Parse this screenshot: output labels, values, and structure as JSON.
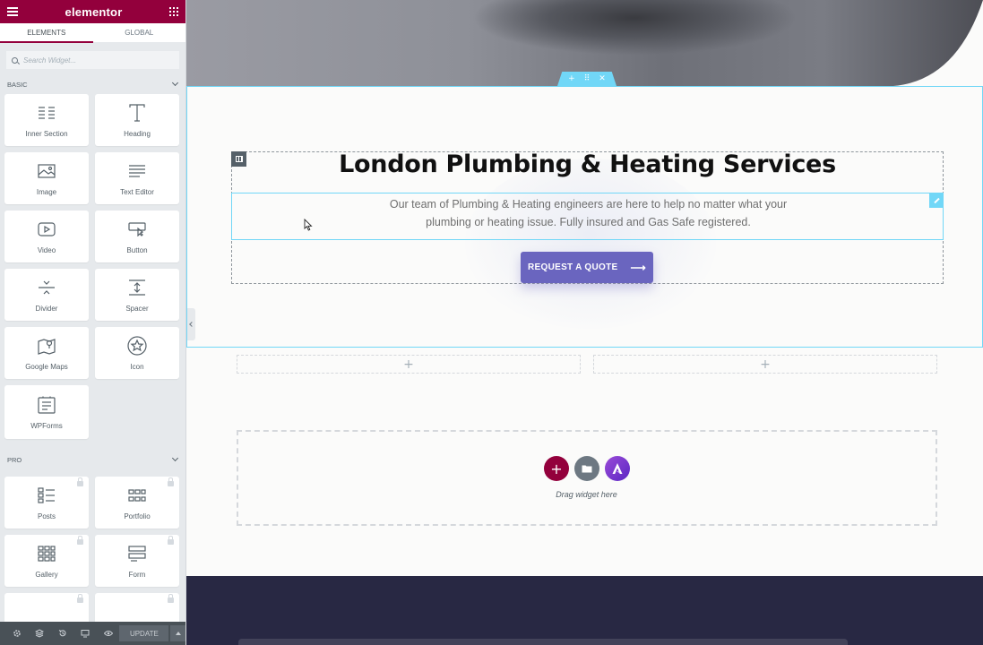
{
  "sidebar": {
    "logo": "elementor",
    "tabs": [
      "ELEMENTS",
      "GLOBAL"
    ],
    "search_placeholder": "Search Widget...",
    "categories": {
      "basic": {
        "title": "BASIC",
        "items": [
          {
            "label": "Inner Section",
            "icon": "inner-section-icon"
          },
          {
            "label": "Heading",
            "icon": "heading-icon"
          },
          {
            "label": "Image",
            "icon": "image-icon"
          },
          {
            "label": "Text Editor",
            "icon": "text-editor-icon"
          },
          {
            "label": "Video",
            "icon": "video-icon"
          },
          {
            "label": "Button",
            "icon": "button-icon"
          },
          {
            "label": "Divider",
            "icon": "divider-icon"
          },
          {
            "label": "Spacer",
            "icon": "spacer-icon"
          },
          {
            "label": "Google Maps",
            "icon": "map-icon"
          },
          {
            "label": "Icon",
            "icon": "star-icon"
          },
          {
            "label": "WPForms",
            "icon": "wpforms-icon"
          }
        ]
      },
      "pro": {
        "title": "PRO",
        "items": [
          {
            "label": "Posts",
            "icon": "posts-icon"
          },
          {
            "label": "Portfolio",
            "icon": "portfolio-icon"
          },
          {
            "label": "Gallery",
            "icon": "gallery-icon"
          },
          {
            "label": "Form",
            "icon": "form-icon"
          }
        ]
      }
    },
    "footer": {
      "update_label": "UPDATE"
    }
  },
  "canvas": {
    "heading": "London Plumbing & Heating Services",
    "description": "Our team of Plumbing & Heating engineers are here to help no matter what your plumbing or heating issue. Fully insured and Gas Safe registered.",
    "cta_label": "REQUEST A QUOTE",
    "cta_arrow": "⟶",
    "section_handle": {
      "add": "+",
      "move": "⠿",
      "close": "✕"
    },
    "empty_column_plus": "+",
    "add_section_plus": "+",
    "drag_hint": "Drag widget here"
  },
  "colors": {
    "brand": "#93003c",
    "selection": "#71d7f7",
    "cta": "#6a65bf",
    "footer_band": "#282843"
  }
}
